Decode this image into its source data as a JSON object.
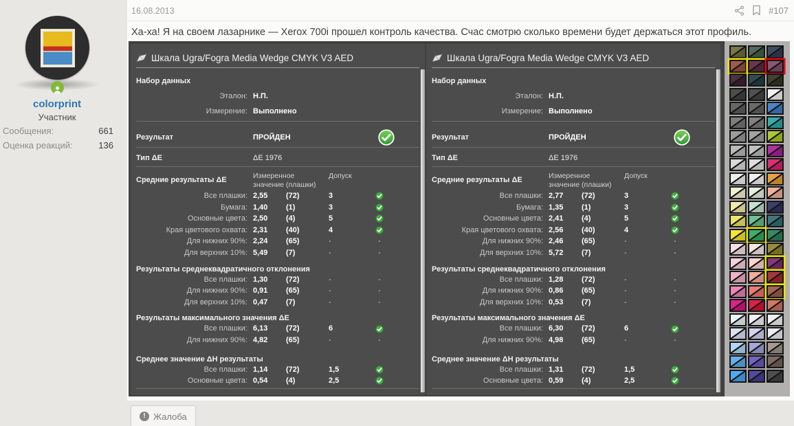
{
  "header": {
    "date": "16.08.2013",
    "post_number": "#107"
  },
  "post": {
    "text": "Ха-ха! Я на своем лазарнике — Xerox 700i прошел контроль качества. Счас смотрю сколько времени будет держаться этот профиль."
  },
  "user": {
    "name": "colorprint",
    "role": "Участник",
    "stats": [
      {
        "label": "Сообщения:",
        "value": "661"
      },
      {
        "label": "Оценка реакций:",
        "value": "136"
      }
    ]
  },
  "footer": {
    "report_label": "Жалоба"
  },
  "icons": {
    "header": [
      "share-icon",
      "bookmark-icon"
    ],
    "panel_title": "wedge-icon",
    "pass": "check-icon",
    "online": "user-online-icon",
    "report": "alert-icon"
  },
  "colors": {
    "panel_bg": "#4c4c4c",
    "pass_green": "#3fa53f",
    "username_blue": "#2d77b3",
    "highlight_yellow": "#eae400",
    "highlight_red": "#e30613"
  },
  "panel_labels": {
    "title": "Шкала Ugra/Fogra Media Wedge CMYK V3 AED",
    "dataset_heading": "Набор данных",
    "reference_label": "Эталон:",
    "measurement_label": "Измерение:",
    "result_heading": "Результат",
    "de_type_heading": "Тип ΔE",
    "col_measured": "Измеренное значение (плашки)",
    "col_tolerance": "Допуск"
  },
  "panels": [
    {
      "reference": "Н.П.",
      "measurement": "Выполнено",
      "result": "ПРОЙДЕН",
      "de_type": "ΔE 1976",
      "sections": [
        {
          "heading": "Средние результаты ΔE",
          "rows": [
            [
              "Все плашки:",
              "2,55",
              "(72)",
              "3",
              true
            ],
            [
              "Бумага:",
              "1,40",
              "(1)",
              "3",
              true
            ],
            [
              "Основные цвета:",
              "2,50",
              "(4)",
              "5",
              true
            ],
            [
              "Края цветового охвата:",
              "2,31",
              "(40)",
              "4",
              true
            ],
            [
              "Для нижних 90%:",
              "2,24",
              "(65)",
              "-",
              false
            ],
            [
              "Для верхних 10%:",
              "5,49",
              "(7)",
              "-",
              false
            ]
          ]
        },
        {
          "heading": "Результаты среднеквадратичного отклонения",
          "rows": [
            [
              "Все плашки:",
              "1,30",
              "(72)",
              "-",
              false
            ],
            [
              "Для нижних 90%:",
              "0,91",
              "(65)",
              "-",
              false
            ],
            [
              "Для верхних 10%:",
              "0,47",
              "(7)",
              "-",
              false
            ]
          ]
        },
        {
          "heading": "Результаты максимального значения ΔE",
          "rows": [
            [
              "Все плашки:",
              "6,13",
              "(72)",
              "6",
              true
            ],
            [
              "Для нижних 90%:",
              "4,82",
              "(65)",
              "-",
              false
            ]
          ]
        },
        {
          "heading": "Среднее значение ΔH результаты",
          "rows": [
            [
              "Все плашки:",
              "1,14",
              "(72)",
              "1,5",
              true
            ],
            [
              "Основные цвета:",
              "0,54",
              "(4)",
              "2,5",
              true
            ]
          ]
        }
      ]
    },
    {
      "reference": "Н.П.",
      "measurement": "Выполнено",
      "result": "ПРОЙДЕН",
      "de_type": "ΔE 1976",
      "sections": [
        {
          "heading": "Средние результаты ΔE",
          "rows": [
            [
              "Все плашки:",
              "2,77",
              "(72)",
              "3",
              true
            ],
            [
              "Бумага:",
              "1,35",
              "(1)",
              "3",
              true
            ],
            [
              "Основные цвета:",
              "2,41",
              "(4)",
              "5",
              true
            ],
            [
              "Края цветового охвата:",
              "2,56",
              "(40)",
              "4",
              true
            ],
            [
              "Для нижних 90%:",
              "2,46",
              "(65)",
              "-",
              false
            ],
            [
              "Для верхних 10%:",
              "5,72",
              "(7)",
              "-",
              false
            ]
          ]
        },
        {
          "heading": "Результаты среднеквадратичного отклонения",
          "rows": [
            [
              "Все плашки:",
              "1,28",
              "(72)",
              "-",
              false
            ],
            [
              "Для нижних 90%:",
              "0,86",
              "(65)",
              "-",
              false
            ],
            [
              "Для верхних 10%:",
              "0,53",
              "(7)",
              "-",
              false
            ]
          ]
        },
        {
          "heading": "Результаты максимального значения ΔE",
          "rows": [
            [
              "Все плашки:",
              "6,30",
              "(72)",
              "6",
              true
            ],
            [
              "Для нижних 90%:",
              "4,98",
              "(65)",
              "-",
              false
            ]
          ]
        },
        {
          "heading": "Среднее значение ΔH результаты",
          "rows": [
            [
              "Все плашки:",
              "1,31",
              "(72)",
              "1,5",
              true
            ],
            [
              "Основные цвета:",
              "0,59",
              "(4)",
              "2,5",
              true
            ]
          ]
        }
      ]
    }
  ],
  "swatches": {
    "rows": [
      [
        [
          "#6e6e3a",
          ""
        ],
        [
          "#44604c",
          ""
        ],
        [
          "#2f3e55",
          ""
        ]
      ],
      [
        [
          "#9a4f40",
          "y"
        ],
        [
          "#5e2740",
          "y"
        ],
        [
          "#7e4a68",
          "r"
        ]
      ],
      [
        [
          "#3e2132",
          ""
        ],
        [
          "#203e44",
          ""
        ],
        [
          "#34341f",
          ""
        ]
      ],
      [
        [
          "#3f3f3f",
          ""
        ],
        [
          "#444444",
          ""
        ],
        [
          "#f2f2f2",
          ""
        ]
      ],
      [
        [
          "#5a5a5a",
          ""
        ],
        [
          "#5f5f5f",
          ""
        ],
        [
          "#3b7cc4",
          ""
        ]
      ],
      [
        [
          "#747474",
          ""
        ],
        [
          "#797979",
          ""
        ],
        [
          "#2aa7a7",
          ""
        ]
      ],
      [
        [
          "#969696",
          ""
        ],
        [
          "#9b9b9b",
          ""
        ],
        [
          "#a8c425",
          ""
        ]
      ],
      [
        [
          "#b6b6b6",
          ""
        ],
        [
          "#bbbbbb",
          ""
        ],
        [
          "#a8219a",
          ""
        ]
      ],
      [
        [
          "#d6d6d6",
          ""
        ],
        [
          "#dbdbdb",
          ""
        ],
        [
          "#d92069",
          ""
        ]
      ],
      [
        [
          "#ededed",
          ""
        ],
        [
          "#efefef",
          ""
        ],
        [
          "#e39b35",
          ""
        ]
      ],
      [
        [
          "#f0eecf",
          ""
        ],
        [
          "#e4efe0",
          ""
        ],
        [
          "#edac97",
          ""
        ]
      ],
      [
        [
          "#eee9a5",
          ""
        ],
        [
          "#bfe0cc",
          ""
        ],
        [
          "#303061",
          ""
        ]
      ],
      [
        [
          "#eae264",
          ""
        ],
        [
          "#61bb8a",
          ""
        ],
        [
          "#2f6f74",
          ""
        ]
      ],
      [
        [
          "#f2e228",
          ""
        ],
        [
          "#2fa75e",
          "y"
        ],
        [
          "#27805a",
          ""
        ]
      ],
      [
        [
          "#f7dfe4",
          ""
        ],
        [
          "#f7e4e0",
          ""
        ],
        [
          "#8f8228",
          ""
        ]
      ],
      [
        [
          "#f2cedb",
          ""
        ],
        [
          "#f7d4cb",
          ""
        ],
        [
          "#7e2874",
          "y"
        ]
      ],
      [
        [
          "#eeadc4",
          ""
        ],
        [
          "#f2a696",
          ""
        ],
        [
          "#9c2832",
          "y"
        ]
      ],
      [
        [
          "#e87eb4",
          ""
        ],
        [
          "#e87368",
          ""
        ],
        [
          "#9c5a4c",
          "y"
        ]
      ],
      [
        [
          "#d9117e",
          ""
        ],
        [
          "#d91135",
          ""
        ],
        [
          "#cc6e5e",
          ""
        ]
      ],
      [
        [
          "#eaf2f7",
          ""
        ],
        [
          "#f0f0f7",
          ""
        ],
        [
          "#efeff2",
          ""
        ]
      ],
      [
        [
          "#d8def2",
          ""
        ],
        [
          "#cfcff2",
          ""
        ],
        [
          "#eaeaf2",
          ""
        ]
      ],
      [
        [
          "#abd4f2",
          ""
        ],
        [
          "#a0a0d9",
          ""
        ],
        [
          "#a09089",
          ""
        ]
      ],
      [
        [
          "#59abea",
          ""
        ],
        [
          "#6859bb",
          ""
        ],
        [
          "#726158",
          ""
        ]
      ],
      [
        [
          "#44a5ef",
          ""
        ],
        [
          "#443e92",
          ""
        ],
        [
          "#434343",
          ""
        ]
      ]
    ]
  }
}
